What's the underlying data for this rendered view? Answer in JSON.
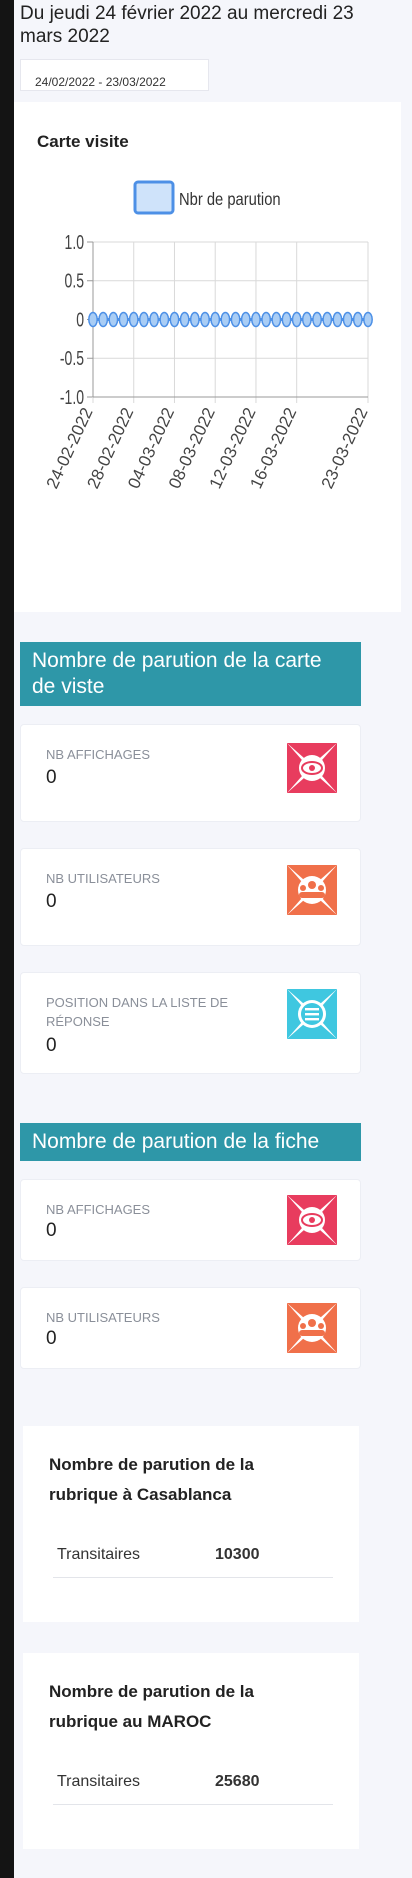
{
  "period_title": "Du jeudi 24 février 2022 au mercredi 23 mars 2022",
  "date_range_input": "24/02/2022 - 23/03/2022",
  "chart_card_title": "Carte visite",
  "colors": {
    "accent": "#2e97a8",
    "series": "#4d90e6",
    "eye_icon": "#e83c5e",
    "users_icon": "#f0704a",
    "list_icon": "#3fc7e0"
  },
  "chart_data": {
    "type": "line",
    "title": "",
    "legend": "top-center",
    "series": [
      {
        "name": "Nbr de parution",
        "x": [
          "24-02-2022",
          "25-02-2022",
          "26-02-2022",
          "27-02-2022",
          "28-02-2022",
          "01-03-2022",
          "02-03-2022",
          "03-03-2022",
          "04-03-2022",
          "05-03-2022",
          "06-03-2022",
          "07-03-2022",
          "08-03-2022",
          "09-03-2022",
          "10-03-2022",
          "11-03-2022",
          "12-03-2022",
          "13-03-2022",
          "14-03-2022",
          "15-03-2022",
          "16-03-2022",
          "17-03-2022",
          "18-03-2022",
          "19-03-2022",
          "20-03-2022",
          "21-03-2022",
          "22-03-2022",
          "23-03-2022"
        ],
        "values": [
          0,
          0,
          0,
          0,
          0,
          0,
          0,
          0,
          0,
          0,
          0,
          0,
          0,
          0,
          0,
          0,
          0,
          0,
          0,
          0,
          0,
          0,
          0,
          0,
          0,
          0,
          0,
          0
        ]
      }
    ],
    "x_tick_labels": [
      "24-02-2022",
      "28-02-2022",
      "04-03-2022",
      "08-03-2022",
      "12-03-2022",
      "16-03-2022",
      "23-03-2022"
    ],
    "y_tick_labels": [
      "1.0",
      "0.5",
      "0",
      "-0.5",
      "-1.0"
    ],
    "ylim": [
      -1.0,
      1.0
    ],
    "grid": true
  },
  "carte_section": {
    "title": "Nombre de parution de la carte de viste",
    "cards": [
      {
        "label": "NB AFFICHAGES",
        "value": "0",
        "icon": "eye-icon"
      },
      {
        "label": "NB UTILISATEURS",
        "value": "0",
        "icon": "users-icon"
      },
      {
        "label": "POSITION DANS LA LISTE DE RÉPONSE",
        "value": "0",
        "icon": "list-icon"
      }
    ]
  },
  "fiche_section": {
    "title": "Nombre de parution de la fiche",
    "cards": [
      {
        "label": "NB AFFICHAGES",
        "value": "0",
        "icon": "eye-icon"
      },
      {
        "label": "NB UTILISATEURS",
        "value": "0",
        "icon": "users-icon"
      }
    ]
  },
  "rubrique_casablanca": {
    "title": "Nombre de parution de la rubrique à Casablanca",
    "category": "Transitaires",
    "count": "10300"
  },
  "rubrique_maroc": {
    "title": "Nombre de parution de la rubrique au MAROC",
    "category": "Transitaires",
    "count": "25680"
  }
}
